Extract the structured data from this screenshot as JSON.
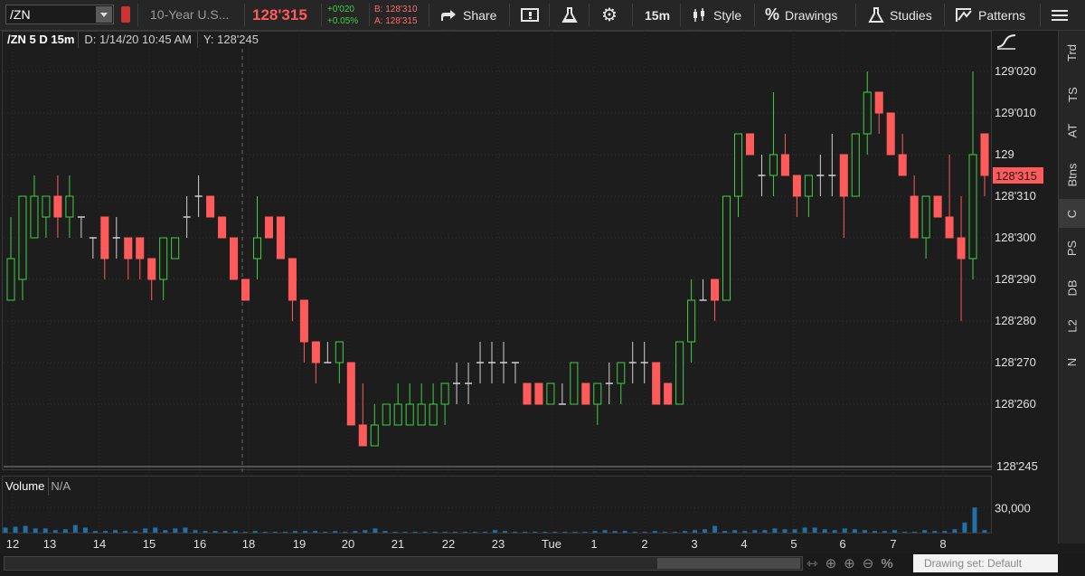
{
  "toolbar": {
    "symbol": "/ZN",
    "description": "10-Year U.S...",
    "last_price": "128'315",
    "net_change": "+0'020",
    "pct_change": "+0.05%",
    "bid": "B: 128'310",
    "ask": "A: 128'315",
    "share": "Share",
    "interval": "15m",
    "style": "Style",
    "drawings": "Drawings",
    "studies": "Studies",
    "patterns": "Patterns"
  },
  "chart_header": {
    "title": "/ZN 5 D 15m",
    "date": "D: 1/14/20 10:45 AM",
    "y": "Y: 128'245"
  },
  "price_axis": {
    "labels": [
      "129'020",
      "129'010",
      "129",
      "128'310",
      "128'300",
      "128'290",
      "128'280",
      "128'270",
      "128'260",
      "128'245"
    ],
    "last_marker": "128'315"
  },
  "volume": {
    "label": "Volume",
    "value": "N/A",
    "axis_label": "30,000"
  },
  "time_axis": [
    "12",
    "13",
    "14",
    "15",
    "16",
    "18",
    "19",
    "20",
    "21",
    "22",
    "23",
    "Tue",
    "1",
    "2",
    "3",
    "4",
    "5",
    "6",
    "7",
    "8"
  ],
  "side_tabs": [
    "Trd",
    "TS",
    "AT",
    "Btns",
    "C",
    "PS",
    "DB",
    "L2",
    "N"
  ],
  "status": {
    "drawing_set": "Drawing set: Default"
  },
  "colors": {
    "up": "#3fd13f",
    "down": "#ff5b5b",
    "volume": "#1f6fa8"
  },
  "chart_data": {
    "type": "candlestick",
    "title": "/ZN 5 D 15m",
    "price_unit": "32nds of a point",
    "ylim": [
      "128'245",
      "129'025"
    ],
    "candles": [
      {
        "o": "128'285",
        "h": "128'305",
        "l": "128'285",
        "c": "128'295"
      },
      {
        "o": "128'290",
        "h": "128'310",
        "l": "128'285",
        "c": "128'310"
      },
      {
        "o": "128'300",
        "h": "128'315",
        "l": "128'300",
        "c": "128'310"
      },
      {
        "o": "128'305",
        "h": "128'310",
        "l": "128'300",
        "c": "128'310"
      },
      {
        "o": "128'310",
        "h": "128'315",
        "l": "128'300",
        "c": "128'305"
      },
      {
        "o": "128'305",
        "h": "128'315",
        "l": "128'300",
        "c": "128'310"
      },
      {
        "o": "128'305",
        "h": "128'305",
        "l": "128'300",
        "c": "128'305"
      },
      {
        "o": "128'300",
        "h": "128'300",
        "l": "128'295",
        "c": "128'300"
      },
      {
        "o": "128'305",
        "h": "128'305",
        "l": "128'290",
        "c": "128'295"
      },
      {
        "o": "128'300",
        "h": "128'305",
        "l": "128'295",
        "c": "128'300"
      },
      {
        "o": "128'300",
        "h": "128'300",
        "l": "128'290",
        "c": "128'295"
      },
      {
        "o": "128'300",
        "h": "128'300",
        "l": "128'290",
        "c": "128'295"
      },
      {
        "o": "128'295",
        "h": "128'295",
        "l": "128'285",
        "c": "128'290"
      },
      {
        "o": "128'290",
        "h": "128'300",
        "l": "128'285",
        "c": "128'300"
      },
      {
        "o": "128'295",
        "h": "128'300",
        "l": "128'295",
        "c": "128'300"
      },
      {
        "o": "128'305",
        "h": "128'310",
        "l": "128'300",
        "c": "128'305"
      },
      {
        "o": "128'310",
        "h": "128'315",
        "l": "128'305",
        "c": "128'310"
      },
      {
        "o": "128'310",
        "h": "128'310",
        "l": "128'305",
        "c": "128'305"
      },
      {
        "o": "128'305",
        "h": "128'305",
        "l": "128'300",
        "c": "128'300"
      },
      {
        "o": "128'300",
        "h": "128'300",
        "l": "128'290",
        "c": "128'290"
      },
      {
        "o": "128'290",
        "h": "128'290",
        "l": "128'285",
        "c": "128'285"
      },
      {
        "o": "128'295",
        "h": "128'310",
        "l": "128'290",
        "c": "128'300"
      },
      {
        "o": "128'305",
        "h": "128'305",
        "l": "128'300",
        "c": "128'300"
      },
      {
        "o": "128'305",
        "h": "128'305",
        "l": "128'295",
        "c": "128'295"
      },
      {
        "o": "128'295",
        "h": "128'295",
        "l": "128'280",
        "c": "128'285"
      },
      {
        "o": "128'285",
        "h": "128'285",
        "l": "128'270",
        "c": "128'275"
      },
      {
        "o": "128'275",
        "h": "128'275",
        "l": "128'265",
        "c": "128'270"
      },
      {
        "o": "128'270",
        "h": "128'275",
        "l": "128'270",
        "c": "128'270"
      },
      {
        "o": "128'270",
        "h": "128'275",
        "l": "128'265",
        "c": "128'275"
      },
      {
        "o": "128'270",
        "h": "128'270",
        "l": "128'260",
        "c": "128'255"
      },
      {
        "o": "128'255",
        "h": "128'265",
        "l": "128'250",
        "c": "128'250"
      },
      {
        "o": "128'250",
        "h": "128'260",
        "l": "128'250",
        "c": "128'255"
      },
      {
        "o": "128'255",
        "h": "128'260",
        "l": "128'255",
        "c": "128'260"
      },
      {
        "o": "128'255",
        "h": "128'265",
        "l": "128'255",
        "c": "128'260"
      },
      {
        "o": "128'255",
        "h": "128'265",
        "l": "128'255",
        "c": "128'260"
      },
      {
        "o": "128'255",
        "h": "128'265",
        "l": "128'255",
        "c": "128'260"
      },
      {
        "o": "128'255",
        "h": "128'265",
        "l": "128'255",
        "c": "128'260"
      },
      {
        "o": "128'260",
        "h": "128'265",
        "l": "128'255",
        "c": "128'265"
      },
      {
        "o": "128'265",
        "h": "128'270",
        "l": "128'260",
        "c": "128'265"
      },
      {
        "o": "128'265",
        "h": "128'270",
        "l": "128'260",
        "c": "128'265"
      },
      {
        "o": "128'270",
        "h": "128'275",
        "l": "128'265",
        "c": "128'270"
      },
      {
        "o": "128'270",
        "h": "128'275",
        "l": "128'265",
        "c": "128'270"
      },
      {
        "o": "128'270",
        "h": "128'275",
        "l": "128'265",
        "c": "128'270"
      },
      {
        "o": "128'270",
        "h": "128'270",
        "l": "128'265",
        "c": "128'270"
      },
      {
        "o": "128'265",
        "h": "128'265",
        "l": "128'260",
        "c": "128'260"
      },
      {
        "o": "128'265",
        "h": "128'265",
        "l": "128'260",
        "c": "128'260"
      },
      {
        "o": "128'260",
        "h": "128'265",
        "l": "128'260",
        "c": "128'265"
      },
      {
        "o": "128'260",
        "h": "128'265",
        "l": "128'260",
        "c": "128'260"
      },
      {
        "o": "128'260",
        "h": "128'270",
        "l": "128'260",
        "c": "128'270"
      },
      {
        "o": "128'265",
        "h": "128'265",
        "l": "128'260",
        "c": "128'260"
      },
      {
        "o": "128'260",
        "h": "128'265",
        "l": "128'255",
        "c": "128'265"
      },
      {
        "o": "128'265",
        "h": "128'270",
        "l": "128'260",
        "c": "128'265"
      },
      {
        "o": "128'265",
        "h": "128'270",
        "l": "128'260",
        "c": "128'270"
      },
      {
        "o": "128'270",
        "h": "128'275",
        "l": "128'265",
        "c": "128'270"
      },
      {
        "o": "128'270",
        "h": "128'275",
        "l": "128'265",
        "c": "128'270"
      },
      {
        "o": "128'270",
        "h": "128'270",
        "l": "128'260",
        "c": "128'260"
      },
      {
        "o": "128'265",
        "h": "128'265",
        "l": "128'260",
        "c": "128'260"
      },
      {
        "o": "128'260",
        "h": "128'275",
        "l": "128'260",
        "c": "128'275"
      },
      {
        "o": "128'275",
        "h": "128'290",
        "l": "128'270",
        "c": "128'285"
      },
      {
        "o": "128'285",
        "h": "128'290",
        "l": "128'285",
        "c": "128'285"
      },
      {
        "o": "128'290",
        "h": "128'290",
        "l": "128'280",
        "c": "128'285"
      },
      {
        "o": "128'285",
        "h": "128'310",
        "l": "128'285",
        "c": "128'310"
      },
      {
        "o": "128'310",
        "h": "128'315",
        "l": "128'305",
        "c": "129'005"
      },
      {
        "o": "129'005",
        "h": "129'005",
        "l": "129'000",
        "c": "129'000"
      },
      {
        "o": "128'315",
        "h": "129'000",
        "l": "128'310",
        "c": "128'315"
      },
      {
        "o": "128'315",
        "h": "129'015",
        "l": "128'310",
        "c": "129'000"
      },
      {
        "o": "129'000",
        "h": "129'005",
        "l": "128'315",
        "c": "128'315"
      },
      {
        "o": "128'315",
        "h": "128'315",
        "l": "128'305",
        "c": "128'310"
      },
      {
        "o": "128'310",
        "h": "128'315",
        "l": "128'305",
        "c": "128'315"
      },
      {
        "o": "128'315",
        "h": "129'000",
        "l": "128'310",
        "c": "128'315"
      },
      {
        "o": "128'315",
        "h": "129'005",
        "l": "128'310",
        "c": "128'315"
      },
      {
        "o": "129'000",
        "h": "129'000",
        "l": "128'300",
        "c": "128'310"
      },
      {
        "o": "128'310",
        "h": "129'000",
        "l": "128'310",
        "c": "129'005"
      },
      {
        "o": "129'005",
        "h": "129'020",
        "l": "129'000",
        "c": "129'015"
      },
      {
        "o": "129'015",
        "h": "129'015",
        "l": "129'005",
        "c": "129'010"
      },
      {
        "o": "129'010",
        "h": "129'010",
        "l": "129'000",
        "c": "129'000"
      },
      {
        "o": "129'000",
        "h": "129'005",
        "l": "128'315",
        "c": "128'315"
      },
      {
        "o": "128'310",
        "h": "128'315",
        "l": "128'300",
        "c": "128'300"
      },
      {
        "o": "128'300",
        "h": "128'310",
        "l": "128'295",
        "c": "128'310"
      },
      {
        "o": "128'310",
        "h": "128'310",
        "l": "128'305",
        "c": "128'305"
      },
      {
        "o": "128'305",
        "h": "129'000",
        "l": "128'300",
        "c": "128'300"
      },
      {
        "o": "128'300",
        "h": "128'310",
        "l": "128'280",
        "c": "128'295"
      },
      {
        "o": "128'295",
        "h": "129'020",
        "l": "128'290",
        "c": "129'000"
      },
      {
        "o": "129'005",
        "h": "129'005",
        "l": "128'310",
        "c": "128'315"
      }
    ],
    "volume_scale_max": 40000,
    "volume": [
      6000,
      7000,
      8000,
      5000,
      5000,
      3000,
      4000,
      9000,
      6000,
      2000,
      2000,
      3000,
      2000,
      2000,
      5000,
      6000,
      3000,
      5000,
      6000,
      3000,
      2000,
      2000,
      2000,
      2000,
      1000,
      2000,
      1000,
      1000,
      1000,
      2000,
      2000,
      2000,
      1000,
      2000,
      1000,
      2000,
      3000,
      5000,
      2000,
      1000,
      1000,
      1000,
      1000,
      1000,
      1000,
      1000,
      1000,
      1000,
      1000,
      3000,
      2000,
      1000,
      1000,
      1000,
      1000,
      1000,
      1000,
      1000,
      1000,
      2000,
      3000,
      2000,
      2000,
      1000,
      1000,
      2000,
      1000,
      1000,
      2000,
      3000,
      4000,
      8000,
      2000,
      3000,
      2000,
      3000,
      3000,
      5000,
      4000,
      4000,
      6000,
      6000,
      4000,
      3000,
      5000,
      4000,
      3000,
      2000,
      2000,
      3000,
      1000,
      1000,
      3000,
      2000,
      2000,
      4000,
      12000,
      30000,
      3000
    ]
  }
}
